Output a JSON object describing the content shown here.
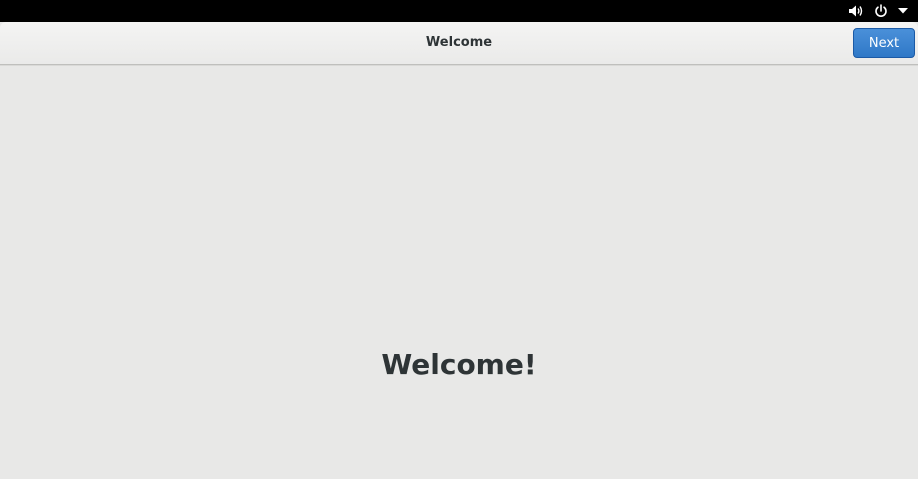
{
  "topbar": {
    "icons": [
      "volume-icon",
      "power-icon",
      "dropdown-arrow-icon"
    ]
  },
  "header": {
    "title": "Welcome",
    "next_label": "Next"
  },
  "main": {
    "heading": "Welcome!"
  },
  "colors": {
    "accent": "#3584e4",
    "background": "#e8e8e7",
    "topbar": "#000000",
    "text": "#2e3436"
  }
}
